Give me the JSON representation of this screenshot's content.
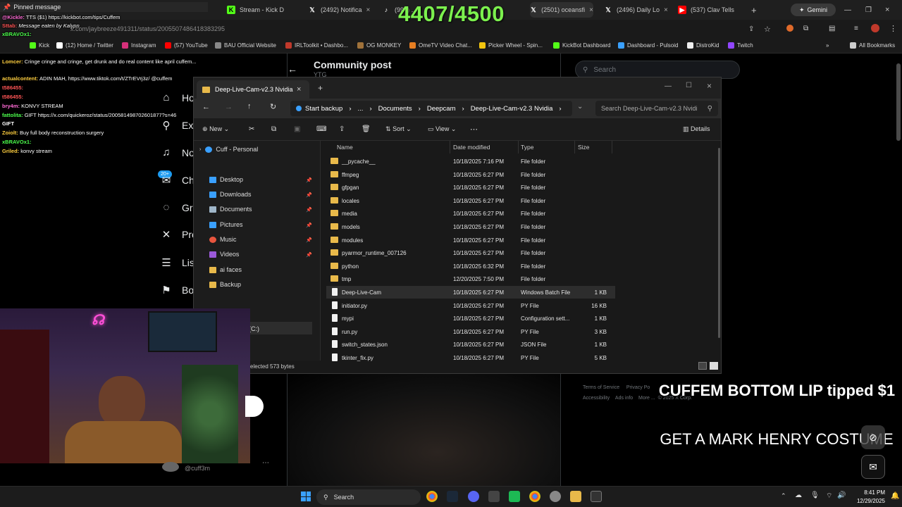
{
  "browser": {
    "tabs": [
      {
        "label": "Stream - Kick D",
        "icon": "kick-icon"
      },
      {
        "label": "(2492) Notifica",
        "icon": "x-icon"
      },
      {
        "label": "(99+) ...",
        "icon": "tiktok-icon"
      },
      {
        "label": "(2501) oceansfi",
        "icon": "x-icon"
      },
      {
        "label": "(2496) Daily Lo",
        "icon": "x-icon"
      },
      {
        "label": "(537) Clav Tells",
        "icon": "youtube-icon"
      }
    ],
    "gemini_label": "Gemini",
    "url": "x.com/jaybreeze491311/status/2005507486418383295",
    "bookmarks": [
      "Kick",
      "(12) Home / Twitter",
      "Instagram",
      "(57) YouTube",
      "BAU Official Website",
      "IRLToolkit • Dashbo...",
      "OG MONKEY",
      "OmeTV Video Chat...",
      "Picker Wheel - Spin...",
      "KickBot Dashboard",
      "Dashboard - Pulsoid",
      "DistroKid",
      "Twitch"
    ],
    "all_bookmarks": "All Bookmarks"
  },
  "counter": "4407/4500",
  "chat": {
    "pinned": "Pinned message",
    "lines": [
      {
        "user": "@Kickle:",
        "text": "TTS ($1) https://kickbot.com/tips/Cuffem",
        "color": "#ff6bd6"
      },
      {
        "user": "Sttab:",
        "text": "Message eaten by Kalypn",
        "color": "#ff5555"
      },
      {
        "user": "xBRAVOx1:",
        "text": "",
        "color": "#4cff4c"
      },
      {
        "user": "Lomcer:",
        "text": "Cringe cringe and cringe, get drunk and do real content like april cuffem...",
        "color": "#ffcf3f"
      },
      {
        "user": "actualcontent:",
        "text": "ADIN MAH, https://www.tiktok.com/t/ZTrEVrj3z/ @cuffem",
        "color": "#ffcf3f"
      },
      {
        "user": "t586455:",
        "text": "",
        "color": "#ff5555"
      },
      {
        "user": "t586455:",
        "text": "",
        "color": "#ff5555"
      },
      {
        "user": "bry4m:",
        "text": "KONVY STREAM",
        "color": "#ff6bd6"
      },
      {
        "user": "fattolita:",
        "text": "GIFT https://x.com/quickeroz/status/200581498702601877?s=46",
        "color": "#4cff4c"
      },
      {
        "user": "GIFT",
        "text": "",
        "color": "#ffffff"
      },
      {
        "user": "Zoiolt:",
        "text": "Buy full body reconstruction surgery",
        "color": "#ffcf3f"
      },
      {
        "user": "xBRAVOx1:",
        "text": "",
        "color": "#4cff4c"
      },
      {
        "user": "Griled:",
        "text": "konvy stream",
        "color": "#ffcf3f"
      }
    ]
  },
  "x_page": {
    "title": "Community post",
    "subtitle": "YTG",
    "search_placeholder": "Search",
    "nav": [
      "Ho",
      "Exp",
      "No",
      "Ch",
      "Gro",
      "Pre",
      "Lis",
      "Bo"
    ],
    "footer": [
      "Terms of Service",
      "Privacy Po",
      "Accessibility",
      "Ads info",
      "More ...",
      "© 2025 X Corp."
    ],
    "handle": "@cuff3m",
    "badge": "20+"
  },
  "explorer": {
    "tab_title": "Deep-Live-Cam-v2.3 Nvidia",
    "breadcrumb": [
      "Start backup",
      "...",
      "Documents",
      "Deepcam",
      "Deep-Live-Cam-v2.3 Nvidia"
    ],
    "search_placeholder": "Search Deep-Live-Cam-v2.3 Nvidi",
    "commands": {
      "new": "New",
      "sort": "Sort",
      "view": "View",
      "details": "Details"
    },
    "sidebar": {
      "top": "Cuff - Personal",
      "items": [
        {
          "label": "Desktop",
          "color": "#3aa0ff",
          "pinned": true
        },
        {
          "label": "Downloads",
          "color": "#3aa0ff",
          "pinned": true
        },
        {
          "label": "Documents",
          "color": "#9fb6c9",
          "pinned": true
        },
        {
          "label": "Pictures",
          "color": "#3aa0ff",
          "pinned": true
        },
        {
          "label": "Music",
          "color": "#e8553e",
          "pinned": true
        },
        {
          "label": "Videos",
          "color": "#9b59d9",
          "pinned": true
        },
        {
          "label": "ai faces",
          "color": "#e8b94a",
          "pinned": false
        },
        {
          "label": "Backup",
          "color": "#e8b94a",
          "pinned": false
        }
      ],
      "drive": "(C:)"
    },
    "columns": {
      "name": "Name",
      "date": "Date modified",
      "type": "Type",
      "size": "Size"
    },
    "files": [
      {
        "name": "__pycache__",
        "date": "10/18/2025 7:16 PM",
        "type": "File folder",
        "size": "",
        "kind": "folder"
      },
      {
        "name": "ffmpeg",
        "date": "10/18/2025 6:27 PM",
        "type": "File folder",
        "size": "",
        "kind": "folder"
      },
      {
        "name": "gfpgan",
        "date": "10/18/2025 6:27 PM",
        "type": "File folder",
        "size": "",
        "kind": "folder"
      },
      {
        "name": "locales",
        "date": "10/18/2025 6:27 PM",
        "type": "File folder",
        "size": "",
        "kind": "folder"
      },
      {
        "name": "media",
        "date": "10/18/2025 6:27 PM",
        "type": "File folder",
        "size": "",
        "kind": "folder"
      },
      {
        "name": "models",
        "date": "10/18/2025 6:27 PM",
        "type": "File folder",
        "size": "",
        "kind": "folder"
      },
      {
        "name": "modules",
        "date": "10/18/2025 6:27 PM",
        "type": "File folder",
        "size": "",
        "kind": "folder"
      },
      {
        "name": "pyarmor_runtime_007126",
        "date": "10/18/2025 6:27 PM",
        "type": "File folder",
        "size": "",
        "kind": "folder"
      },
      {
        "name": "python",
        "date": "10/18/2025 6:32 PM",
        "type": "File folder",
        "size": "",
        "kind": "folder"
      },
      {
        "name": "tmp",
        "date": "12/20/2025 7:50 PM",
        "type": "File folder",
        "size": "",
        "kind": "folder"
      },
      {
        "name": "Deep-Live-Cam",
        "date": "10/18/2025 6:27 PM",
        "type": "Windows Batch File",
        "size": "1 KB",
        "kind": "file"
      },
      {
        "name": "initiator.py",
        "date": "10/18/2025 6:27 PM",
        "type": "PY File",
        "size": "16 KB",
        "kind": "file"
      },
      {
        "name": "mypi",
        "date": "10/18/2025 6:27 PM",
        "type": "Configuration sett...",
        "size": "1 KB",
        "kind": "file"
      },
      {
        "name": "run.py",
        "date": "10/18/2025 6:27 PM",
        "type": "PY File",
        "size": "3 KB",
        "kind": "file"
      },
      {
        "name": "switch_states.json",
        "date": "10/18/2025 6:27 PM",
        "type": "JSON File",
        "size": "1 KB",
        "kind": "file"
      },
      {
        "name": "tkinter_fix.py",
        "date": "10/18/2025 6:27 PM",
        "type": "PY File",
        "size": "5 KB",
        "kind": "file"
      }
    ],
    "status": "elected  573 bytes"
  },
  "captions": {
    "line1": "CUFFEM BOTTOM LIP tipped $1",
    "line2": "GET A MARK HENRY COSTUME"
  },
  "taskbar": {
    "search": "Search",
    "time": "8:41 PM",
    "date": "12/29/2025"
  }
}
